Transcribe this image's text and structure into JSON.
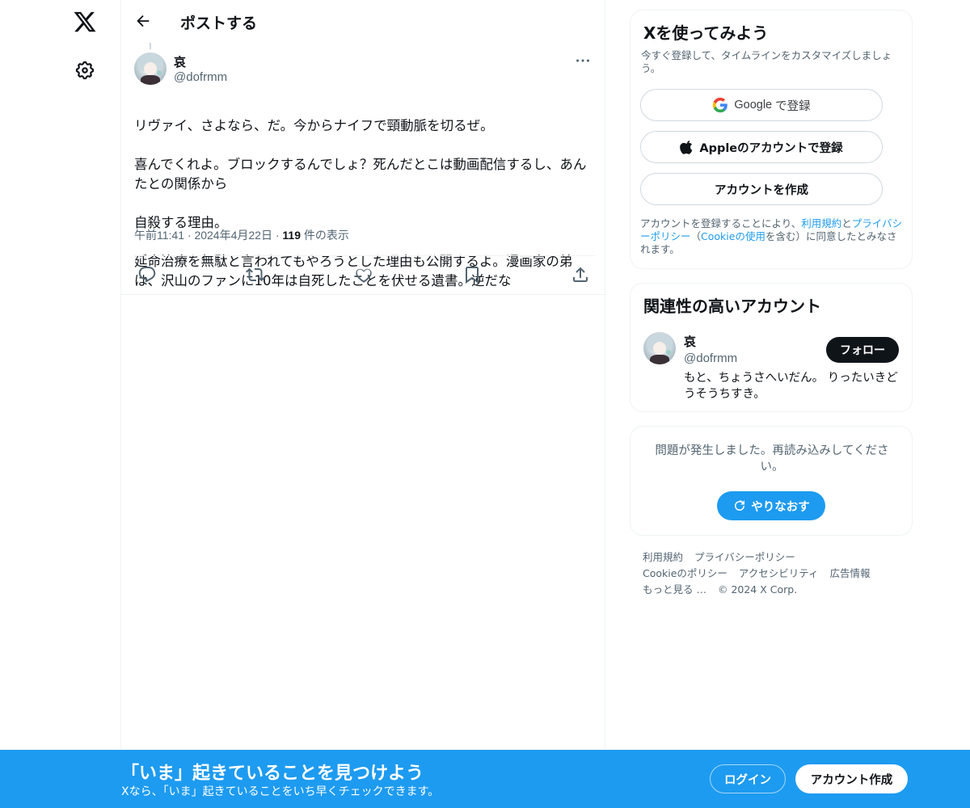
{
  "nav": {
    "logo_icon": "x-logo-icon",
    "settings_icon": "gear-icon"
  },
  "header": {
    "title": "ポストする"
  },
  "post": {
    "author_name": "哀",
    "author_handle": "@dofrmm",
    "lines": [
      "リヴァイ、さよなら、だ。今からナイフで頸動脈を切るぜ。",
      "喜んでくれよ。ブロックするんでしょ？死んだとこは動画配信するし、あんたとの関係から",
      "自殺する理由。",
      "延命治療を無駄と言われてもやろうとした理由も公開するよ。漫画家の弟は、沢山のファンに10年は自死したことを伏せる遺書。逆だな"
    ],
    "time": "午前11:41",
    "date": "2024年4月22日",
    "views_count": "119",
    "views_label": "件の表示",
    "actions": [
      "reply-icon",
      "repost-icon",
      "like-icon",
      "bookmark-icon",
      "share-icon"
    ]
  },
  "signup": {
    "title": "Xを使ってみよう",
    "subtitle": "今すぐ登録して、タイムラインをカスタマイズしましょう。",
    "google_label": "Google",
    "google_suffix": "で登録",
    "apple_label": "Appleのアカウントで登録",
    "create_label": "アカウントを作成",
    "terms_prefix": "アカウントを登録することにより、",
    "terms_link": "利用規約",
    "terms_and": "と",
    "privacy_link": "プライバシーポリシー",
    "terms_open": "（",
    "cookie_link": "Cookieの使用",
    "terms_suffix": "を含む）に同意したとみなされます。"
  },
  "relevant": {
    "title": "関連性の高いアカウント",
    "name": "哀",
    "handle": "@dofrmm",
    "follow_label": "フォロー",
    "bio": "もと、ちょうさへいだん。 りったいきどうそうちすき。"
  },
  "error": {
    "message": "問題が発生しました。再読み込みしてください。",
    "retry_label": "やりなおす"
  },
  "footer": {
    "row1": [
      "利用規約",
      "プライバシーポリシー"
    ],
    "row2": [
      "Cookieのポリシー",
      "アクセシビリティ",
      "広告情報"
    ],
    "row3": [
      "もっと見る …",
      "© 2024 X Corp."
    ]
  },
  "banner": {
    "title": "「いま」起きていることを見つけよう",
    "subtitle": "Xなら、「いま」起きていることをいち早くチェックできます。",
    "login_label": "ログイン",
    "create_label": "アカウント作成"
  },
  "colors": {
    "accent": "#1d9bf0",
    "text": "#0f1419",
    "secondary": "#536471",
    "border": "#eff3f4"
  }
}
